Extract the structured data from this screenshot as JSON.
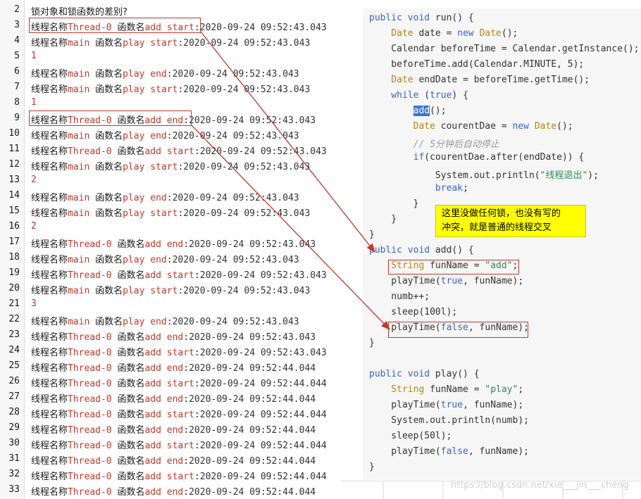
{
  "log": {
    "lines": [
      {
        "num": "2",
        "type": "title",
        "text": "锁对象和锁函数的差别?"
      },
      {
        "num": "3",
        "type": "entry",
        "prefix": "线程名称",
        "thread": "Thread-0",
        "mid": " 函数名",
        "fn": "add",
        "evt": " start",
        "rest": ":2020-09-24 09:52:43.043"
      },
      {
        "num": "4",
        "type": "entry",
        "prefix": "线程名称",
        "thread": "main",
        "mid": " 函数名",
        "fn": "play",
        "evt": " start",
        "rest": ":2020-09-24 09:52:43.043"
      },
      {
        "num": "5",
        "type": "value",
        "text": "1"
      },
      {
        "num": "6",
        "type": "entry",
        "prefix": "线程名称",
        "thread": "main",
        "mid": " 函数名",
        "fn": "play",
        "evt": " end",
        "rest": ":2020-09-24 09:52:43.043"
      },
      {
        "num": "7",
        "type": "entry",
        "prefix": "线程名称",
        "thread": "main",
        "mid": " 函数名",
        "fn": "play",
        "evt": " start",
        "rest": ":2020-09-24 09:52:43.043"
      },
      {
        "num": "8",
        "type": "value",
        "text": "1"
      },
      {
        "num": "9",
        "type": "entry",
        "prefix": "线程名称",
        "thread": "Thread-0",
        "mid": " 函数名",
        "fn": "add",
        "evt": " end",
        "rest": ":2020-09-24 09:52:43.043"
      },
      {
        "num": "10",
        "type": "entry",
        "prefix": "线程名称",
        "thread": "main",
        "mid": " 函数名",
        "fn": "play",
        "evt": " end",
        "rest": ":2020-09-24 09:52:43.043"
      },
      {
        "num": "11",
        "type": "entry",
        "prefix": "线程名称",
        "thread": "Thread-0",
        "mid": " 函数名",
        "fn": "add",
        "evt": " start",
        "rest": ":2020-09-24 09:52:43.043"
      },
      {
        "num": "12",
        "type": "entry",
        "prefix": "线程名称",
        "thread": "main",
        "mid": " 函数名",
        "fn": "play",
        "evt": " start",
        "rest": ":2020-09-24 09:52:43.043"
      },
      {
        "num": "13",
        "type": "value",
        "text": "2"
      },
      {
        "num": "14",
        "type": "entry",
        "prefix": "线程名称",
        "thread": "main",
        "mid": " 函数名",
        "fn": "play",
        "evt": " end",
        "rest": ":2020-09-24 09:52:43.043"
      },
      {
        "num": "15",
        "type": "entry",
        "prefix": "线程名称",
        "thread": "main",
        "mid": " 函数名",
        "fn": "play",
        "evt": " start",
        "rest": ":2020-09-24 09:52:43.043"
      },
      {
        "num": "16",
        "type": "value",
        "text": "2"
      },
      {
        "num": "17",
        "type": "entry",
        "prefix": "线程名称",
        "thread": "Thread-0",
        "mid": " 函数名",
        "fn": "add",
        "evt": " end",
        "rest": ":2020-09-24 09:52:43.043"
      },
      {
        "num": "18",
        "type": "entry",
        "prefix": "线程名称",
        "thread": "main",
        "mid": " 函数名",
        "fn": "play",
        "evt": " end",
        "rest": ":2020-09-24 09:52:43.043"
      },
      {
        "num": "19",
        "type": "entry",
        "prefix": "线程名称",
        "thread": "Thread-0",
        "mid": " 函数名",
        "fn": "add",
        "evt": " start",
        "rest": ":2020-09-24 09:52:43.043"
      },
      {
        "num": "20",
        "type": "entry",
        "prefix": "线程名称",
        "thread": "main",
        "mid": " 函数名",
        "fn": "play",
        "evt": " start",
        "rest": ":2020-09-24 09:52:43.043"
      },
      {
        "num": "21",
        "type": "value",
        "text": "3"
      },
      {
        "num": "22",
        "type": "entry",
        "prefix": "线程名称",
        "thread": "main",
        "mid": " 函数名",
        "fn": "play",
        "evt": " end",
        "rest": ":2020-09-24 09:52:43.043"
      },
      {
        "num": "23",
        "type": "entry",
        "prefix": "线程名称",
        "thread": "Thread-0",
        "mid": " 函数名",
        "fn": "add",
        "evt": " end",
        "rest": ":2020-09-24 09:52:43.043"
      },
      {
        "num": "24",
        "type": "entry",
        "prefix": "线程名称",
        "thread": "Thread-0",
        "mid": " 函数名",
        "fn": "add",
        "evt": " start",
        "rest": ":2020-09-24 09:52:43.043"
      },
      {
        "num": "25",
        "type": "entry",
        "prefix": "线程名称",
        "thread": "Thread-0",
        "mid": " 函数名",
        "fn": "add",
        "evt": " end",
        "rest": ":2020-09-24 09:52:44.044"
      },
      {
        "num": "26",
        "type": "entry",
        "prefix": "线程名称",
        "thread": "Thread-0",
        "mid": " 函数名",
        "fn": "add",
        "evt": " start",
        "rest": ":2020-09-24 09:52:44.044"
      },
      {
        "num": "27",
        "type": "entry",
        "prefix": "线程名称",
        "thread": "Thread-0",
        "mid": " 函数名",
        "fn": "add",
        "evt": " end",
        "rest": ":2020-09-24 09:52:44.044"
      },
      {
        "num": "28",
        "type": "entry",
        "prefix": "线程名称",
        "thread": "Thread-0",
        "mid": " 函数名",
        "fn": "add",
        "evt": " start",
        "rest": ":2020-09-24 09:52:44.044"
      },
      {
        "num": "29",
        "type": "entry",
        "prefix": "线程名称",
        "thread": "Thread-0",
        "mid": " 函数名",
        "fn": "add",
        "evt": " end",
        "rest": ":2020-09-24 09:52:44.044"
      },
      {
        "num": "30",
        "type": "entry",
        "prefix": "线程名称",
        "thread": "Thread-0",
        "mid": " 函数名",
        "fn": "add",
        "evt": " start",
        "rest": ":2020-09-24 09:52:44.044"
      },
      {
        "num": "31",
        "type": "entry",
        "prefix": "线程名称",
        "thread": "Thread-0",
        "mid": " 函数名",
        "fn": "add",
        "evt": " end",
        "rest": ":2020-09-24 09:52:44.044"
      },
      {
        "num": "32",
        "type": "entry",
        "prefix": "线程名称",
        "thread": "Thread-0",
        "mid": " 函数名",
        "fn": "add",
        "evt": " start",
        "rest": ":2020-09-24 09:52:44.044"
      },
      {
        "num": "33",
        "type": "entry",
        "prefix": "线程名称",
        "thread": "Thread-0",
        "mid": " 函数名",
        "fn": "add",
        "evt": " end",
        "rest": ":2020-09-24 09:52:44.044"
      }
    ]
  },
  "code": {
    "lines": [
      [
        {
          "c": "kw",
          "t": "public void "
        },
        {
          "c": "ident",
          "t": "run() {"
        }
      ],
      [
        {
          "c": "ty",
          "t": "    Date "
        },
        {
          "c": "ident",
          "t": "date = "
        },
        {
          "c": "kw",
          "t": "new "
        },
        {
          "c": "ty",
          "t": "Date"
        },
        {
          "c": "ident",
          "t": "();"
        }
      ],
      [
        {
          "c": "ident",
          "t": "    Calendar beforeTime = Calendar.getInstance();"
        }
      ],
      [
        {
          "c": "ident",
          "t": "    beforeTime.add(Calendar.MINUTE, 5);"
        }
      ],
      [
        {
          "c": "ty",
          "t": "    Date "
        },
        {
          "c": "ident",
          "t": "endDate = beforeTime.getTime();"
        }
      ],
      [
        {
          "c": "kw",
          "t": "    while "
        },
        {
          "c": "ident",
          "t": "("
        },
        {
          "c": "kw",
          "t": "true"
        },
        {
          "c": "ident",
          "t": ") {"
        }
      ],
      [
        {
          "c": "ident",
          "t": "        "
        },
        {
          "c": "sel",
          "t": "add"
        },
        {
          "c": "ident",
          "t": "();"
        }
      ],
      [
        {
          "c": "ty",
          "t": "        Date "
        },
        {
          "c": "ident",
          "t": "courentDae = "
        },
        {
          "c": "kw",
          "t": "new "
        },
        {
          "c": "ty",
          "t": "Date"
        },
        {
          "c": "ident",
          "t": "();"
        }
      ],
      [
        {
          "c": "cm",
          "t": "        // 5分钟后自动停止"
        }
      ],
      [
        {
          "c": "kw",
          "t": "        if"
        },
        {
          "c": "ident",
          "t": "(courentDae.after(endDate)) {"
        }
      ],
      [
        {
          "c": "ident",
          "t": "            System.out.println("
        },
        {
          "c": "str",
          "t": "\"线程退出\""
        },
        {
          "c": "ident",
          "t": ");"
        }
      ],
      [
        {
          "c": "kw",
          "t": "            break"
        },
        {
          "c": "ident",
          "t": ";"
        }
      ],
      [
        {
          "c": "ident",
          "t": "        }"
        }
      ],
      [
        {
          "c": "ident",
          "t": "    }"
        }
      ],
      [
        {
          "c": "ident",
          "t": "}"
        }
      ],
      [
        {
          "c": "kw",
          "t": "public void "
        },
        {
          "c": "ident",
          "t": "add() {"
        }
      ],
      [
        {
          "c": "ty",
          "t": "    String "
        },
        {
          "c": "ident",
          "t": "funName = "
        },
        {
          "c": "str",
          "t": "\"add\""
        },
        {
          "c": "ident",
          "t": ";"
        }
      ],
      [
        {
          "c": "ident",
          "t": "    playTime("
        },
        {
          "c": "kw",
          "t": "true"
        },
        {
          "c": "ident",
          "t": ", funName);"
        }
      ],
      [
        {
          "c": "ident",
          "t": "    numb++;"
        }
      ],
      [
        {
          "c": "ident",
          "t": "    sleep(100l);"
        }
      ],
      [
        {
          "c": "ident",
          "t": "    playTime("
        },
        {
          "c": "kw",
          "t": "false"
        },
        {
          "c": "ident",
          "t": ", funName);"
        }
      ],
      [
        {
          "c": "ident",
          "t": "}"
        }
      ],
      [
        {
          "c": "ident",
          "t": ""
        }
      ],
      [
        {
          "c": "kw",
          "t": "public void "
        },
        {
          "c": "ident",
          "t": "play() {"
        }
      ],
      [
        {
          "c": "ty",
          "t": "    String "
        },
        {
          "c": "ident",
          "t": "funName = "
        },
        {
          "c": "str",
          "t": "\"play\""
        },
        {
          "c": "ident",
          "t": ";"
        }
      ],
      [
        {
          "c": "ident",
          "t": "    playTime("
        },
        {
          "c": "kw",
          "t": "true"
        },
        {
          "c": "ident",
          "t": ", funName);"
        }
      ],
      [
        {
          "c": "ident",
          "t": "    System.out.println(numb);"
        }
      ],
      [
        {
          "c": "ident",
          "t": "    sleep(50l);"
        }
      ],
      [
        {
          "c": "ident",
          "t": "    playTime("
        },
        {
          "c": "kw",
          "t": "false"
        },
        {
          "c": "ident",
          "t": ", funName);"
        }
      ],
      [
        {
          "c": "ident",
          "t": "}"
        }
      ]
    ]
  },
  "note": {
    "line1": "这里没做任何锁，也没有写的",
    "line2": "冲突，就是普通的线程交叉"
  },
  "watermark": "https://blog.csdn.net/xie___jin___cheng",
  "colors": {
    "accent_red": "#c0392b",
    "keyword": "#3b64c8",
    "type": "#b8860b",
    "string": "#2e8b57",
    "note_bg": "#ffff00"
  }
}
